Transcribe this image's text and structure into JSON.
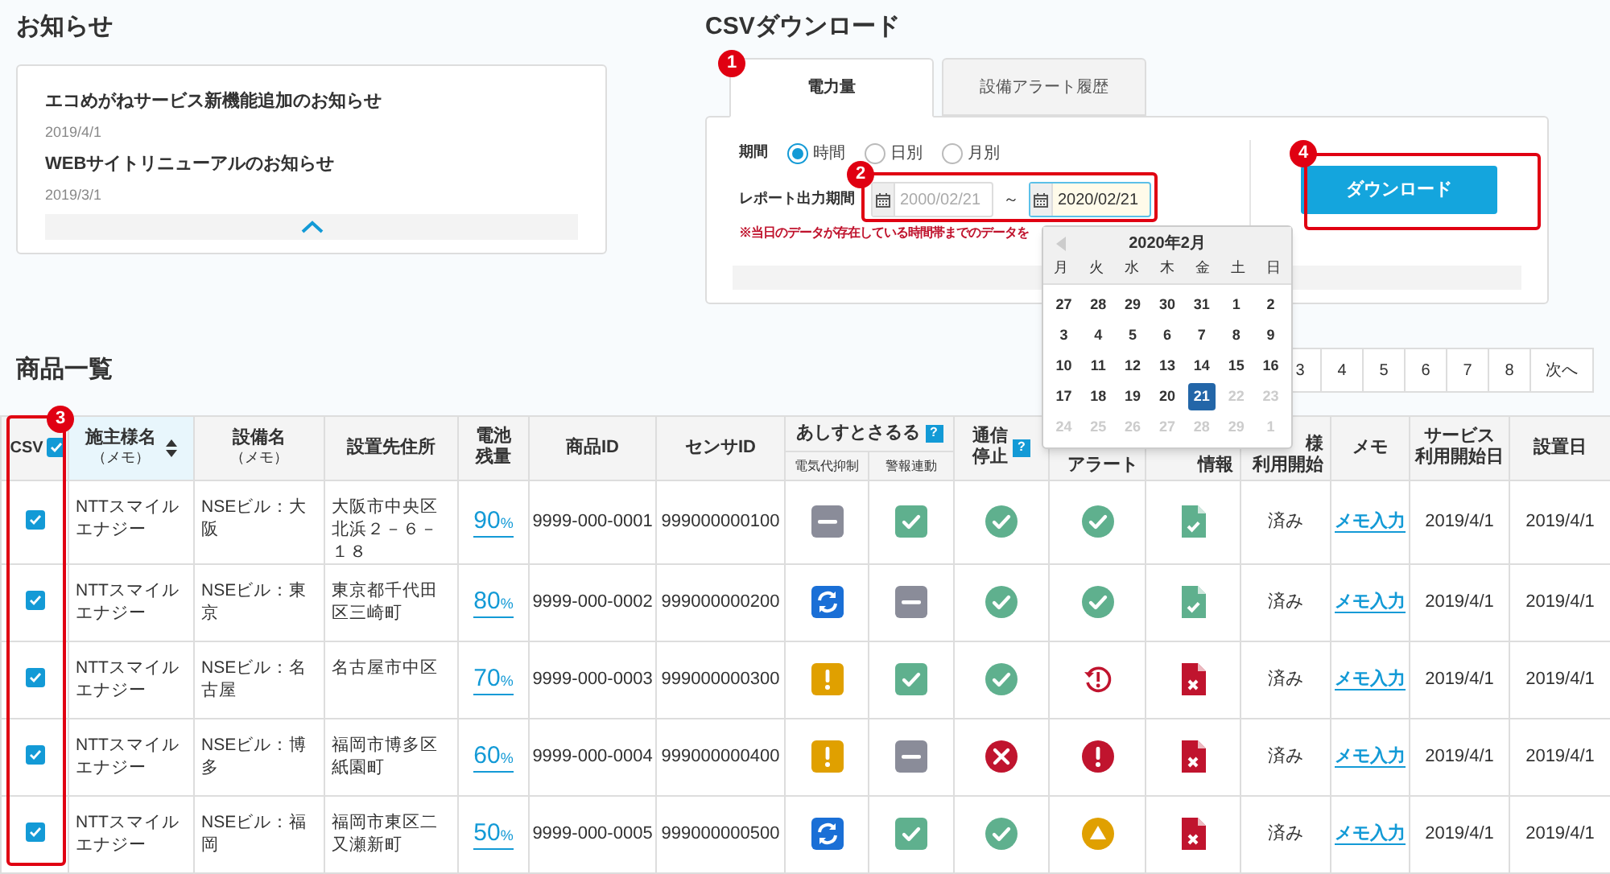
{
  "news": {
    "title": "お知らせ",
    "items": [
      {
        "title": "エコめがねサービス新機能追加のお知らせ",
        "date": "2019/4/1"
      },
      {
        "title": "WEBサイトリニューアルのお知らせ",
        "date": "2019/3/1"
      }
    ]
  },
  "csv_download": {
    "title": "CSVダウンロード",
    "tabs": [
      {
        "label": "電力量",
        "selected": true
      },
      {
        "label": "設備アラート履歴",
        "selected": false
      }
    ],
    "period": {
      "label": "期間",
      "options": [
        {
          "label": "時間",
          "selected": true
        },
        {
          "label": "日別",
          "selected": false
        },
        {
          "label": "月別",
          "selected": false
        }
      ]
    },
    "report_period": {
      "label": "レポート出力期間",
      "from": {
        "value": "2000/02/21",
        "disabled": true
      },
      "separator": "～",
      "to": {
        "value": "2020/02/21",
        "disabled": false
      }
    },
    "note": "※当日のデータが存在している時間帯までのデータを",
    "download_button": "ダウンロード"
  },
  "calendar": {
    "title": "2020年2月",
    "weekdays": [
      "月",
      "火",
      "水",
      "木",
      "金",
      "土",
      "日"
    ],
    "weeks": [
      [
        {
          "day": "27",
          "muted": false,
          "selected": false
        },
        {
          "day": "28",
          "muted": false,
          "selected": false
        },
        {
          "day": "29",
          "muted": false,
          "selected": false
        },
        {
          "day": "30",
          "muted": false,
          "selected": false
        },
        {
          "day": "31",
          "muted": false,
          "selected": false
        },
        {
          "day": "1",
          "muted": false,
          "selected": false
        },
        {
          "day": "2",
          "muted": false,
          "selected": false
        }
      ],
      [
        {
          "day": "3",
          "muted": false,
          "selected": false
        },
        {
          "day": "4",
          "muted": false,
          "selected": false
        },
        {
          "day": "5",
          "muted": false,
          "selected": false
        },
        {
          "day": "6",
          "muted": false,
          "selected": false
        },
        {
          "day": "7",
          "muted": false,
          "selected": false
        },
        {
          "day": "8",
          "muted": false,
          "selected": false
        },
        {
          "day": "9",
          "muted": false,
          "selected": false
        }
      ],
      [
        {
          "day": "10",
          "muted": false,
          "selected": false
        },
        {
          "day": "11",
          "muted": false,
          "selected": false
        },
        {
          "day": "12",
          "muted": false,
          "selected": false
        },
        {
          "day": "13",
          "muted": false,
          "selected": false
        },
        {
          "day": "14",
          "muted": false,
          "selected": false
        },
        {
          "day": "15",
          "muted": false,
          "selected": false
        },
        {
          "day": "16",
          "muted": false,
          "selected": false
        }
      ],
      [
        {
          "day": "17",
          "muted": false,
          "selected": false
        },
        {
          "day": "18",
          "muted": false,
          "selected": false
        },
        {
          "day": "19",
          "muted": false,
          "selected": false
        },
        {
          "day": "20",
          "muted": false,
          "selected": false
        },
        {
          "day": "21",
          "muted": false,
          "selected": true
        },
        {
          "day": "22",
          "muted": true,
          "selected": false
        },
        {
          "day": "23",
          "muted": true,
          "selected": false
        }
      ],
      [
        {
          "day": "24",
          "muted": true,
          "selected": false
        },
        {
          "day": "25",
          "muted": true,
          "selected": false
        },
        {
          "day": "26",
          "muted": true,
          "selected": false
        },
        {
          "day": "27",
          "muted": true,
          "selected": false
        },
        {
          "day": "28",
          "muted": true,
          "selected": false
        },
        {
          "day": "29",
          "muted": true,
          "selected": false
        },
        {
          "day": "1",
          "muted": true,
          "selected": false
        }
      ]
    ]
  },
  "products": {
    "title": "商品一覧",
    "pagination": {
      "pages": [
        "3",
        "4",
        "5",
        "6",
        "7",
        "8"
      ],
      "next": "次へ"
    },
    "header_checkbox": {
      "label": "CSV",
      "checked": true
    },
    "columns": [
      {
        "lines": [
          "施主様名"
        ],
        "sublabel": "（メモ）",
        "sorted": true,
        "covered": false
      },
      {
        "lines": [
          "設備名"
        ],
        "sublabel": "（メモ）",
        "sorted": false,
        "covered": false
      },
      {
        "lines": [
          "設置先住所"
        ],
        "sorted": false,
        "covered": false
      },
      {
        "lines": [
          "電池",
          "残量"
        ],
        "sorted": false,
        "covered": false
      },
      {
        "lines": [
          "商品ID"
        ],
        "sorted": false,
        "covered": false
      },
      {
        "lines": [
          "センサID"
        ],
        "sorted": false,
        "covered": false
      },
      {
        "kind": "group",
        "label": "あしすとさるる",
        "help": "?",
        "children": [
          {
            "label": "電気代抑制"
          },
          {
            "label": "警報連動"
          }
        ]
      },
      {
        "lines": [
          "通信",
          "停止"
        ],
        "help": "?",
        "sorted": false,
        "covered": false
      },
      {
        "lines": [
          "アラート"
        ],
        "sorted": false,
        "covered": true
      },
      {
        "lines": [
          "情報"
        ],
        "sorted": false,
        "covered": true
      },
      {
        "lines": [
          "様",
          "利用開始"
        ],
        "sorted": false,
        "covered": true
      },
      {
        "lines": [
          "メモ"
        ],
        "sorted": false,
        "covered": false
      },
      {
        "lines": [
          "サービス",
          "利用開始日"
        ],
        "sorted": false,
        "covered": false
      },
      {
        "lines": [
          "設置日"
        ],
        "sorted": false,
        "covered": false
      }
    ],
    "rows": [
      {
        "checked": true,
        "owner": "NTTスマイルエナジー",
        "building": "NSEビル：大阪",
        "address": "大阪市中央区北浜２－６－１８",
        "battery": "90",
        "battery_unit": "%",
        "product_id": "9999-000-0001",
        "sensor_id": "999000000100",
        "statuses": [
          {
            "kind": "minus-square"
          },
          {
            "kind": "check-square"
          },
          {
            "kind": "check-circle"
          },
          {
            "kind": "check-circle"
          },
          {
            "kind": "document-check"
          }
        ],
        "usage": "済み",
        "memo": "メモ入力",
        "service_start": "2019/4/1",
        "install_date": "2019/4/1"
      },
      {
        "checked": true,
        "owner": "NTTスマイルエナジー",
        "building": "NSEビル：東京",
        "address": "東京都千代田区三崎町",
        "battery": "80",
        "battery_unit": "%",
        "product_id": "9999-000-0002",
        "sensor_id": "999000000200",
        "statuses": [
          {
            "kind": "sync"
          },
          {
            "kind": "minus-square"
          },
          {
            "kind": "check-circle"
          },
          {
            "kind": "check-circle"
          },
          {
            "kind": "document-check"
          }
        ],
        "usage": "済み",
        "memo": "メモ入力",
        "service_start": "2019/4/1",
        "install_date": "2019/4/1"
      },
      {
        "checked": true,
        "owner": "NTTスマイルエナジー",
        "building": "NSEビル：名古屋",
        "address": "名古屋市中区",
        "battery": "70",
        "battery_unit": "%",
        "product_id": "9999-000-0003",
        "sensor_id": "999000000300",
        "statuses": [
          {
            "kind": "exclamation-square"
          },
          {
            "kind": "check-square"
          },
          {
            "kind": "check-circle"
          },
          {
            "kind": "history"
          },
          {
            "kind": "document-x"
          }
        ],
        "usage": "済み",
        "memo": "メモ入力",
        "service_start": "2019/4/1",
        "install_date": "2019/4/1"
      },
      {
        "checked": true,
        "owner": "NTTスマイルエナジー",
        "building": "NSEビル：博多",
        "address": "福岡市博多区紙園町",
        "battery": "60",
        "battery_unit": "%",
        "product_id": "9999-000-0004",
        "sensor_id": "999000000400",
        "statuses": [
          {
            "kind": "exclamation-square"
          },
          {
            "kind": "minus-square"
          },
          {
            "kind": "x-circle"
          },
          {
            "kind": "exclamation-circle"
          },
          {
            "kind": "document-x"
          }
        ],
        "usage": "済み",
        "memo": "メモ入力",
        "service_start": "2019/4/1",
        "install_date": "2019/4/1"
      },
      {
        "checked": true,
        "owner": "NTTスマイルエナジー",
        "building": "NSEビル：福岡",
        "address": "福岡市東区二又瀬新町",
        "battery": "50",
        "battery_unit": "%",
        "product_id": "9999-000-0005",
        "sensor_id": "999000000500",
        "statuses": [
          {
            "kind": "sync"
          },
          {
            "kind": "check-square"
          },
          {
            "kind": "check-circle"
          },
          {
            "kind": "triangle-circle"
          },
          {
            "kind": "document-x"
          }
        ],
        "usage": "済み",
        "memo": "メモ入力",
        "service_start": "2019/4/1",
        "install_date": "2019/4/1"
      }
    ]
  },
  "annotations": [
    "1",
    "2",
    "3",
    "4"
  ]
}
